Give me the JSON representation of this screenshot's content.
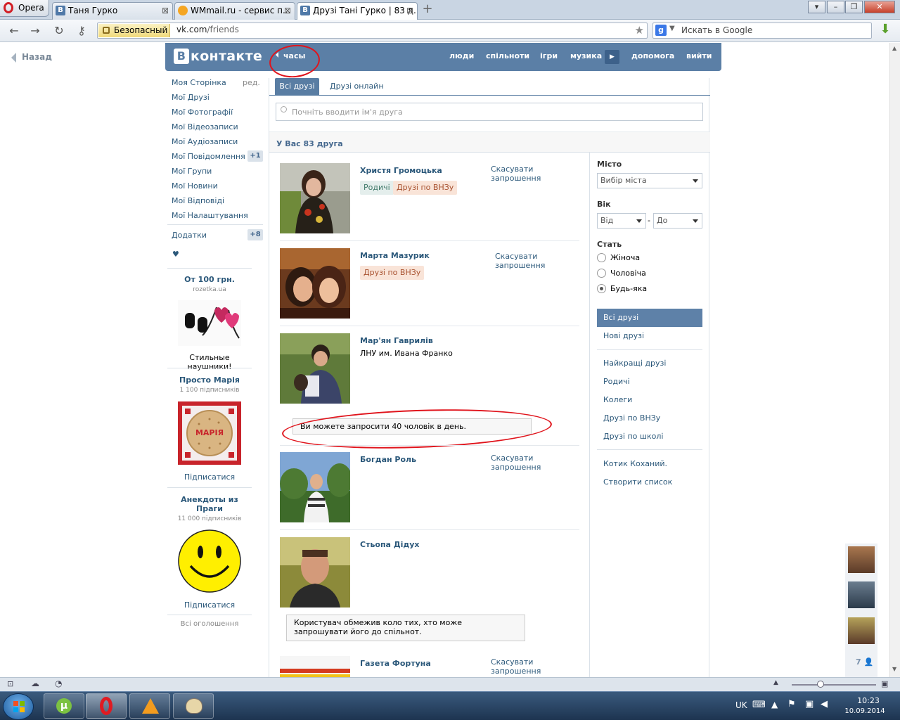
{
  "browser": {
    "menu_label": "Opera",
    "tabs": [
      {
        "label": "Таня Гурко",
        "icon": "vk-icon"
      },
      {
        "label": "WMmail.ru - сервис п...",
        "icon": "wmmail-icon"
      },
      {
        "label": "Друзі Тані Гурко | 83 д...",
        "icon": "vk-icon"
      }
    ],
    "security_label": "Безопасный",
    "url_host": "vk.com",
    "url_path": "/friends",
    "search_placeholder": "Искать в Google"
  },
  "page": {
    "back_label": "Назад",
    "logo_text": "контакте",
    "logo_mark": "В",
    "hours_label": "часы",
    "topnav": [
      "люди",
      "спільноти",
      "ігри",
      "музика",
      "допомога",
      "вийти"
    ],
    "left_menu": [
      {
        "label": "Моя Сторінка",
        "extra": "ред."
      },
      {
        "label": "Мої Друзі"
      },
      {
        "label": "Мої Фотографії"
      },
      {
        "label": "Мої Відеозаписи"
      },
      {
        "label": "Мої Аудіозаписи"
      },
      {
        "label": "Мої Повідомлення",
        "badge": "+1"
      },
      {
        "label": "Мої Групи"
      },
      {
        "label": "Мої Новини"
      },
      {
        "label": "Мої Відповіді"
      },
      {
        "label": "Мої Налаштування"
      }
    ],
    "apps": {
      "label": "Додатки",
      "badge": "+8"
    },
    "heart": "♥",
    "ads": [
      {
        "title": "От 100 грн.",
        "sub": "rozetka.ua",
        "text": "Стильные наушники!"
      },
      {
        "title": "Просто Марія",
        "sub": "1 100 підписників",
        "img_text": "МАРІЯ",
        "link": "Підписатися"
      },
      {
        "title": "Анекдоты из Праги",
        "sub": "11 000 підписників",
        "link": "Підписатися"
      }
    ],
    "all_ads": "Всі оголошення",
    "tabs": {
      "all": "Всі друзі",
      "online": "Друзі онлайн"
    },
    "search_placeholder": "Почніть вводити ім'я друга",
    "count_text": "У Вас 83 друга",
    "friends": [
      {
        "name": "Христя Громоцька",
        "cancel": "Скасувати запрошення",
        "tags": [
          "Родичі",
          "Друзі по ВНЗу"
        ]
      },
      {
        "name": "Марта Мазурик",
        "cancel": "Скасувати запрошення",
        "tags": [
          "Друзі по ВНЗу"
        ]
      },
      {
        "name": "Мар'ян Гаврилів",
        "sub": "ЛНУ им. Ивана Франко",
        "notice": "Ви можете запросити 40 чоловік в день."
      },
      {
        "name": "Богдан Роль",
        "cancel": "Скасувати запрошення"
      },
      {
        "name": "Стьопа Дідух",
        "notice": "Користувач обмежив коло тих, хто може запрошувати його до спільнот."
      },
      {
        "name": "Газета Фортуна",
        "cancel": "Скасувати запрошення"
      }
    ],
    "filter": {
      "city_label": "Місто",
      "city_value": "Вибір міста",
      "age_label": "Вік",
      "age_from": "Від",
      "age_to": "До",
      "age_dash": "-",
      "sex_label": "Стать",
      "sex_options": [
        "Жіноча",
        "Чоловіча",
        "Будь-яка"
      ],
      "sex_selected": 2
    },
    "lists": {
      "active": "Всі друзі",
      "new": "Нові друзі",
      "group1": [
        "Найкращі друзі",
        "Родичі",
        "Колеги",
        "Друзі по ВНЗу",
        "Друзі по школі"
      ],
      "group2": [
        "Котик Коханий.",
        "Створити список"
      ]
    },
    "side_count": "7"
  },
  "taskbar": {
    "lang": "UK",
    "time": "10:23",
    "date": "10.09.2014"
  }
}
